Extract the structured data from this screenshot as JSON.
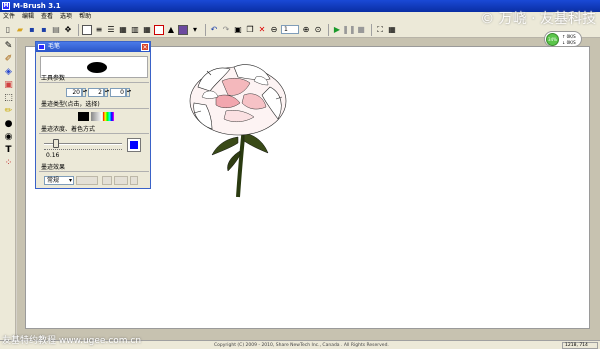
{
  "window": {
    "title": "M-Brush 3.1"
  },
  "menu": [
    "文件",
    "编辑",
    "查看",
    "选项",
    "帮助"
  ],
  "watermark_top": "© 万峣 · 友基科技",
  "watermark_bottom": "友基特约教程 www.ugee.com.cn",
  "toolbar": {
    "zoom_value": "1"
  },
  "brush_panel": {
    "title": "毛笔",
    "params_label": "工具参数",
    "param_values": [
      "20",
      "2",
      "0"
    ],
    "ink_type_label": "墨迹类型(点击，选择)",
    "ink_opacity_label": "墨迹浓度、着色方式",
    "opacity_value": "0.16",
    "opacity_level": 0.16,
    "ink_color": "#0000ff",
    "effect_label": "墨迹效果",
    "effect_value": "常规"
  },
  "speed_widget": {
    "percent": "34%",
    "up": "0K/S",
    "down": "0K/S"
  },
  "statusbar": {
    "copyright": "Copyright (C) 2009 - 2010, Share NewTech Inc., Canada . All Rights Reserved.",
    "coords": "1218, 714"
  },
  "colors": {
    "title_bar": "#0a2ea4",
    "panel_title": "#2a55c8",
    "canvas": "#ffffff"
  }
}
